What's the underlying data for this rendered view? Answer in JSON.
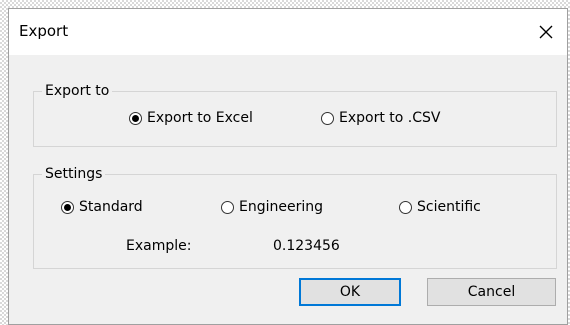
{
  "dialog": {
    "title": "Export",
    "close_icon": "close-icon"
  },
  "export_to": {
    "label": "Export to",
    "options": [
      {
        "label": "Export to Excel",
        "selected": true
      },
      {
        "label": "Export to .CSV",
        "selected": false
      }
    ]
  },
  "settings": {
    "label": "Settings",
    "options": [
      {
        "label": "Standard",
        "selected": true
      },
      {
        "label": "Engineering",
        "selected": false
      },
      {
        "label": "Scientific",
        "selected": false
      }
    ],
    "example_label": "Example:",
    "example_value": "0.123456"
  },
  "buttons": {
    "ok": "OK",
    "cancel": "Cancel"
  },
  "colors": {
    "default_button_border": "#0078d7",
    "dialog_background": "#f0f0f0"
  }
}
